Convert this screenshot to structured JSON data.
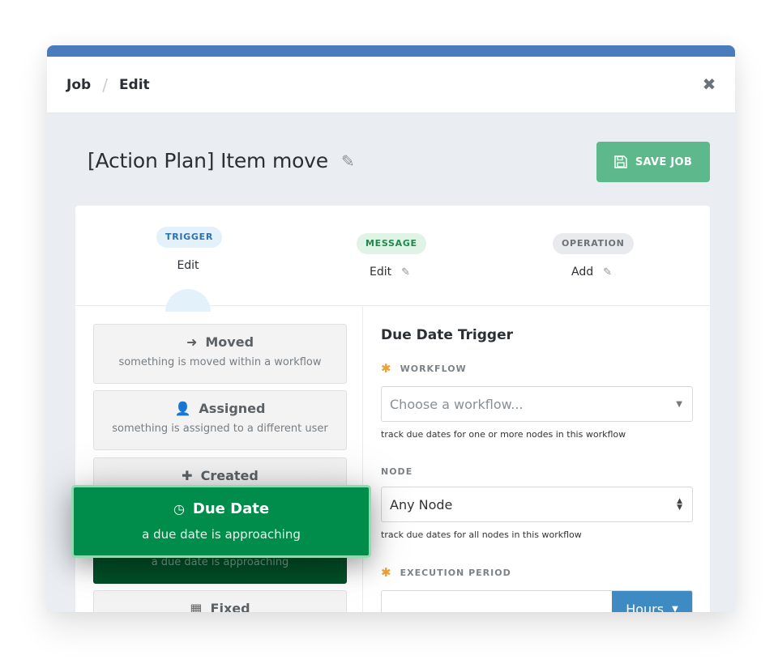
{
  "colors": {
    "topbar": "#4a7bbd",
    "save": "#5db88c",
    "accent_green": "#008c4a",
    "hours": "#3d8bc2",
    "required": "#f0a030"
  },
  "header": {
    "breadcrumb": [
      "Job",
      "Edit"
    ],
    "close_icon": "close-icon"
  },
  "page": {
    "title": "[Action Plan] Item move",
    "save_label": "SAVE JOB"
  },
  "steps": [
    {
      "pill": "TRIGGER",
      "label": "Edit"
    },
    {
      "pill": "MESSAGE",
      "label": "Edit"
    },
    {
      "pill": "OPERATION",
      "label": "Add"
    }
  ],
  "trigger_options": [
    {
      "title": "Moved",
      "desc": "something is moved within a workflow",
      "icon": "arrow-right-icon"
    },
    {
      "title": "Assigned",
      "desc": "something is assigned to a different user",
      "icon": "user-plus-icon"
    },
    {
      "title": "Created",
      "desc": "",
      "icon": "plus-icon"
    },
    {
      "title": "Due Date",
      "desc": "a due date is approaching",
      "icon": "clock-icon"
    },
    {
      "title": "Fixed",
      "desc": "",
      "icon": "calendar-icon"
    }
  ],
  "dragging": {
    "title": "Due Date",
    "desc": "a due date is approaching"
  },
  "form": {
    "title": "Due Date Trigger",
    "workflow": {
      "label": "WORKFLOW",
      "placeholder": "Choose a workflow...",
      "hint": "track due dates for one or more nodes in this workflow"
    },
    "node": {
      "label": "NODE",
      "value": "Any Node",
      "hint": "track due dates for all nodes in this workflow"
    },
    "period": {
      "label": "EXECUTION PERIOD",
      "value": "",
      "unit": "Hours"
    }
  }
}
